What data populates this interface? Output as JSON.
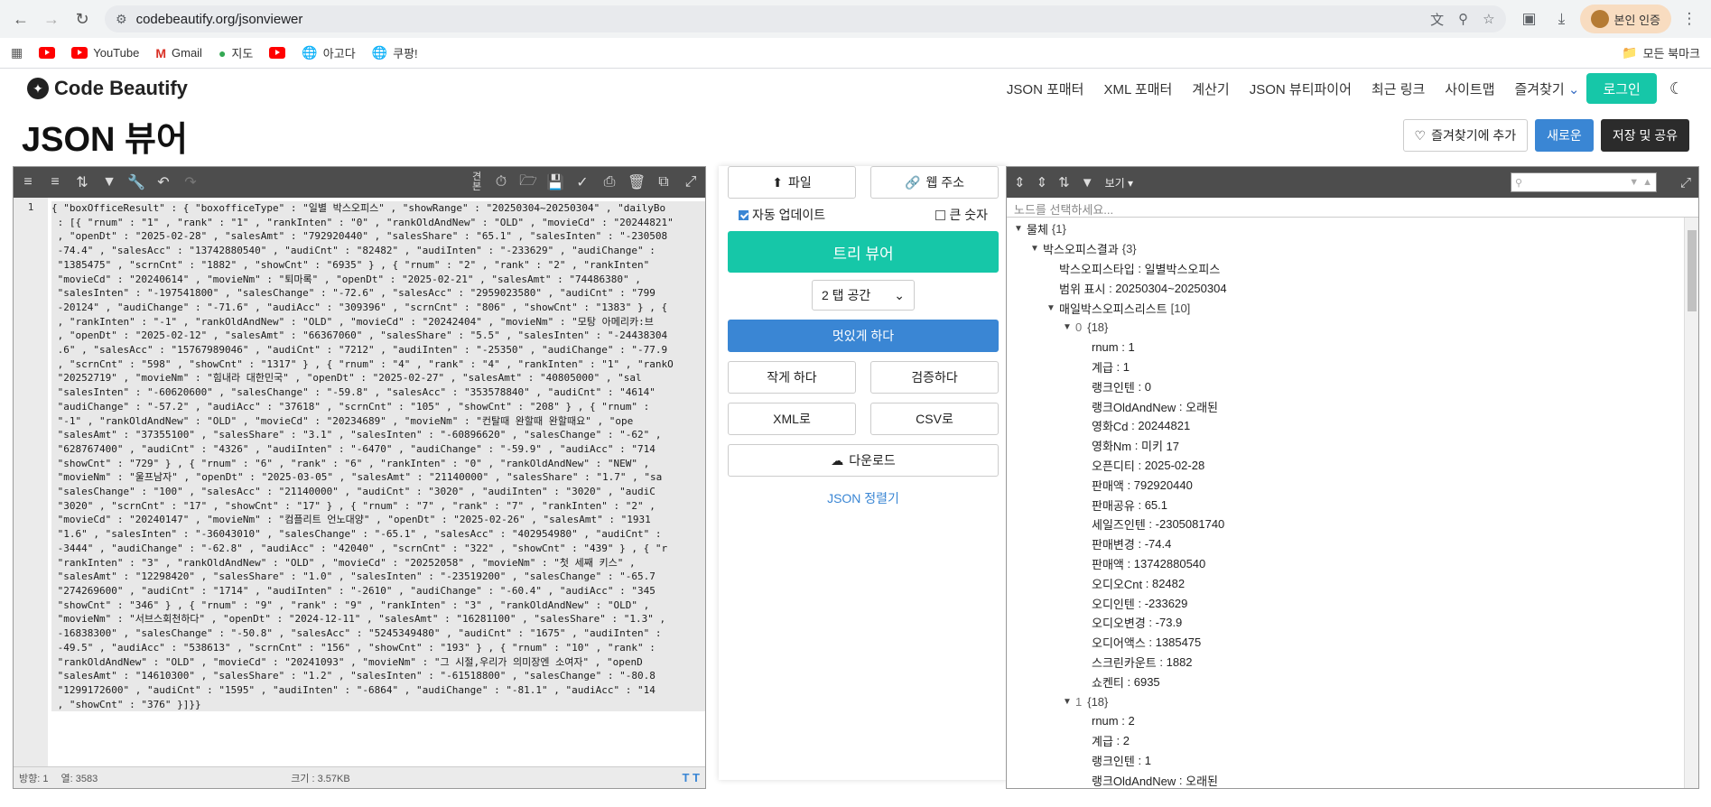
{
  "browser": {
    "url": "codebeautify.org/jsonviewer",
    "verify_label": "본인 인증"
  },
  "bookmarks": {
    "items": [
      {
        "label": ""
      },
      {
        "label": "YouTube"
      },
      {
        "label": "Gmail"
      },
      {
        "label": "지도"
      },
      {
        "label": ""
      },
      {
        "label": "아고다"
      },
      {
        "label": "쿠팡!"
      }
    ],
    "all_label": "모든 북마크"
  },
  "site": {
    "logo": "Code Beautify",
    "nav": [
      "JSON 포매터",
      "XML 포매터",
      "계산기",
      "JSON 뷰티파이어",
      "최근 링크",
      "사이트맵",
      "즐겨찾기"
    ],
    "login": "로그인"
  },
  "page": {
    "title": "JSON 뷰어",
    "fav_button": "즐겨찾기에 추가",
    "new_button": "새로운",
    "save_button": "저장 및 공유"
  },
  "editor": {
    "toolbar_text": "견\n본",
    "line_no": "1",
    "lines": [
      "{ \"boxOfficeResult\" : { \"boxofficeType\" : \"일별 박스오피스\" , \"showRange\" : \"20250304~20250304\" , \"dailyBo",
      " : [{ \"rnum\" : \"1\" , \"rank\" : \"1\" , \"rankInten\" : \"0\" , \"rankOldAndNew\" : \"OLD\" , \"movieCd\" : \"20244821\"",
      " , \"openDt\" : \"2025-02-28\" , \"salesAmt\" : \"792920440\" , \"salesShare\" : \"65.1\" , \"salesInten\" : \"-230508",
      " -74.4\" , \"salesAcc\" : \"13742880540\" , \"audiCnt\" : \"82482\" , \"audiInten\" : \"-233629\" , \"audiChange\" :",
      " \"1385475\" , \"scrnCnt\" : \"1882\" , \"showCnt\" : \"6935\" } , { \"rnum\" : \"2\" , \"rank\" : \"2\" , \"rankInten\"",
      " \"movieCd\" : \"20240614\" , \"movieNm\" : \"퇴마록\" , \"openDt\" : \"2025-02-21\" , \"salesAmt\" : \"74486380\" ,",
      " \"salesInten\" : \"-197541800\" , \"salesChange\" : \"-72.6\" , \"salesAcc\" : \"2959023580\" , \"audiCnt\" : \"799",
      " -20124\" , \"audiChange\" : \"-71.6\" , \"audiAcc\" : \"309396\" , \"scrnCnt\" : \"806\" , \"showCnt\" : \"1383\" } , {",
      " , \"rankInten\" : \"-1\" , \"rankOldAndNew\" : \"OLD\" , \"movieCd\" : \"20242404\" , \"movieNm\" : \"모탕 아메리카:브",
      " , \"openDt\" : \"2025-02-12\" , \"salesAmt\" : \"66367060\" , \"salesShare\" : \"5.5\" , \"salesInten\" : \"-24438304",
      " .6\" , \"salesAcc\" : \"15767989046\" , \"audiCnt\" : \"7212\" , \"audiInten\" : \"-25350\" , \"audiChange\" : \"-77.9",
      " , \"scrnCnt\" : \"598\" , \"showCnt\" : \"1317\" } , { \"rnum\" : \"4\" , \"rank\" : \"4\" , \"rankInten\" : \"1\" , \"rankO",
      " \"20252719\" , \"movieNm\" : \"힘내라 대한민국\" , \"openDt\" : \"2025-02-27\" , \"salesAmt\" : \"40805000\" , \"sal",
      " \"salesInten\" : \"-60620600\" , \"salesChange\" : \"-59.8\" , \"salesAcc\" : \"353578840\" , \"audiCnt\" : \"4614\"",
      " \"audiChange\" : \"-57.2\" , \"audiAcc\" : \"37618\" , \"scrnCnt\" : \"105\" , \"showCnt\" : \"208\" } , { \"rnum\" :",
      " \"-1\" , \"rankOldAndNew\" : \"OLD\" , \"movieCd\" : \"20234689\" , \"movieNm\" : \"컨탈때 완할때 완할때요\" , \"ope",
      " \"salesAmt\" : \"37355100\" , \"salesShare\" : \"3.1\" , \"salesInten\" : \"-60896620\" , \"salesChange\" : \"-62\" ,",
      " \"628767400\" , \"audiCnt\" : \"4326\" , \"audiInten\" : \"-6470\" , \"audiChange\" : \"-59.9\" , \"audiAcc\" : \"714",
      " \"showCnt\" : \"729\" } , { \"rnum\" : \"6\" , \"rank\" : \"6\" , \"rankInten\" : \"0\" , \"rankOldAndNew\" : \"NEW\" ,",
      " \"movieNm\" : \"울프남자\" , \"openDt\" : \"2025-03-05\" , \"salesAmt\" : \"21140000\" , \"salesShare\" : \"1.7\" , \"sa",
      " \"salesChange\" : \"100\" , \"salesAcc\" : \"21140000\" , \"audiCnt\" : \"3020\" , \"audiInten\" : \"3020\" , \"audiC",
      " \"3020\" , \"scrnCnt\" : \"17\" , \"showCnt\" : \"17\" } , { \"rnum\" : \"7\" , \"rank\" : \"7\" , \"rankInten\" : \"2\" ,",
      " \"movieCd\" : \"20240147\" , \"movieNm\" : \"컴플리트 언노대양\" , \"openDt\" : \"2025-02-26\" , \"salesAmt\" : \"1931",
      " \"1.6\" , \"salesInten\" : \"-36043010\" , \"salesChange\" : \"-65.1\" , \"salesAcc\" : \"402954980\" , \"audiCnt\" :",
      " -3444\" , \"audiChange\" : \"-62.8\" , \"audiAcc\" : \"42040\" , \"scrnCnt\" : \"322\" , \"showCnt\" : \"439\" } , { \"r",
      " \"rankInten\" : \"3\" , \"rankOldAndNew\" : \"OLD\" , \"movieCd\" : \"20252058\" , \"movieNm\" : \"첫 세째 키스\" ,",
      " \"salesAmt\" : \"12298420\" , \"salesShare\" : \"1.0\" , \"salesInten\" : \"-23519200\" , \"salesChange\" : \"-65.7",
      " \"274269600\" , \"audiCnt\" : \"1714\" , \"audiInten\" : \"-2610\" , \"audiChange\" : \"-60.4\" , \"audiAcc\" : \"345",
      " \"showCnt\" : \"346\" } , { \"rnum\" : \"9\" , \"rank\" : \"9\" , \"rankInten\" : \"3\" , \"rankOldAndNew\" : \"OLD\" ,",
      " \"movieNm\" : \"서브스회천하다\" , \"openDt\" : \"2024-12-11\" , \"salesAmt\" : \"16281100\" , \"salesShare\" : \"1.3\" ,",
      " -16838300\" , \"salesChange\" : \"-50.8\" , \"salesAcc\" : \"5245349480\" , \"audiCnt\" : \"1675\" , \"audiInten\" :",
      " -49.5\" , \"audiAcc\" : \"538613\" , \"scrnCnt\" : \"156\" , \"showCnt\" : \"193\" } , { \"rnum\" : \"10\" , \"rank\" :",
      " \"rankOldAndNew\" : \"OLD\" , \"movieCd\" : \"20241093\" , \"movieNm\" : \"그 시절,우리가 의미장엔 소여자\" , \"openD",
      " \"salesAmt\" : \"14610300\" , \"salesShare\" : \"1.2\" , \"salesInten\" : \"-61518800\" , \"salesChange\" : \"-80.8",
      " \"1299172600\" , \"audiCnt\" : \"1595\" , \"audiInten\" : \"-6864\" , \"audiChange\" : \"-81.1\" , \"audiAcc\" : \"14",
      " , \"showCnt\" : \"376\" }]}}"
    ],
    "status_row": "방향: 1",
    "status_col": "열: 3583",
    "status_size": "크기 : 3.57KB"
  },
  "middle": {
    "file_button": "파일",
    "url_button": "웹 주소",
    "auto_update": "자동 업데이트",
    "big_number": "큰 숫자",
    "tree_viewer": "트리 뷰어",
    "indent_select": "2 탭 공간",
    "beautify": "멋있게 하다",
    "minify": "작게 하다",
    "validate": "검증하다",
    "to_xml": "XML로",
    "to_csv": "CSV로",
    "download": "다운로드",
    "sort_link": "JSON 정렬기"
  },
  "viewer": {
    "view_menu": "보기",
    "path_placeholder": "노드를 선택하세요...",
    "nodes": [
      {
        "depth": 0,
        "arrow": "▼",
        "key": "물체",
        "count": "{1}",
        "idx": ""
      },
      {
        "depth": 1,
        "arrow": "▼",
        "key": "박스오피스결과",
        "count": "{3}",
        "idx": ""
      },
      {
        "depth": 2,
        "arrow": "",
        "key": "박스오피스타입",
        "value": "일별박스오피스"
      },
      {
        "depth": 2,
        "arrow": "",
        "key": "범위 표시",
        "value": "20250304~20250304"
      },
      {
        "depth": 2,
        "arrow": "▼",
        "key": "매일박스오피스리스트",
        "count": "[10]",
        "idx": ""
      },
      {
        "depth": 3,
        "arrow": "▼",
        "key": "0",
        "count": "{18}",
        "idx": "true"
      },
      {
        "depth": 4,
        "arrow": "",
        "key": "rnum",
        "value": "1"
      },
      {
        "depth": 4,
        "arrow": "",
        "key": "계급",
        "value": "1"
      },
      {
        "depth": 4,
        "arrow": "",
        "key": "랭크인텐",
        "value": "0"
      },
      {
        "depth": 4,
        "arrow": "",
        "key": "랭크OldAndNew",
        "value": "오래된"
      },
      {
        "depth": 4,
        "arrow": "",
        "key": "영화Cd",
        "value": "20244821"
      },
      {
        "depth": 4,
        "arrow": "",
        "key": "영화Nm",
        "value": "미키 17"
      },
      {
        "depth": 4,
        "arrow": "",
        "key": "오픈디티",
        "value": "2025-02-28"
      },
      {
        "depth": 4,
        "arrow": "",
        "key": "판매액",
        "value": "792920440"
      },
      {
        "depth": 4,
        "arrow": "",
        "key": "판매공유",
        "value": "65.1"
      },
      {
        "depth": 4,
        "arrow": "",
        "key": "세일즈인텐",
        "value": "-2305081740"
      },
      {
        "depth": 4,
        "arrow": "",
        "key": "판매변경",
        "value": "-74.4"
      },
      {
        "depth": 4,
        "arrow": "",
        "key": "판매액",
        "value": "13742880540"
      },
      {
        "depth": 4,
        "arrow": "",
        "key": "오디오Cnt",
        "value": "82482"
      },
      {
        "depth": 4,
        "arrow": "",
        "key": "오디인텐",
        "value": "-233629"
      },
      {
        "depth": 4,
        "arrow": "",
        "key": "오디오변경",
        "value": "-73.9"
      },
      {
        "depth": 4,
        "arrow": "",
        "key": "오디어액스",
        "value": "1385475"
      },
      {
        "depth": 4,
        "arrow": "",
        "key": "스크린카운트",
        "value": "1882"
      },
      {
        "depth": 4,
        "arrow": "",
        "key": "쇼켄티",
        "value": "6935"
      },
      {
        "depth": 3,
        "arrow": "▼",
        "key": "1",
        "count": "{18}",
        "idx": "true"
      },
      {
        "depth": 4,
        "arrow": "",
        "key": "rnum",
        "value": "2"
      },
      {
        "depth": 4,
        "arrow": "",
        "key": "계급",
        "value": "2"
      },
      {
        "depth": 4,
        "arrow": "",
        "key": "랭크인텐",
        "value": "1"
      },
      {
        "depth": 4,
        "arrow": "",
        "key": "랭크OldAndNew",
        "value": "오래된"
      }
    ]
  }
}
